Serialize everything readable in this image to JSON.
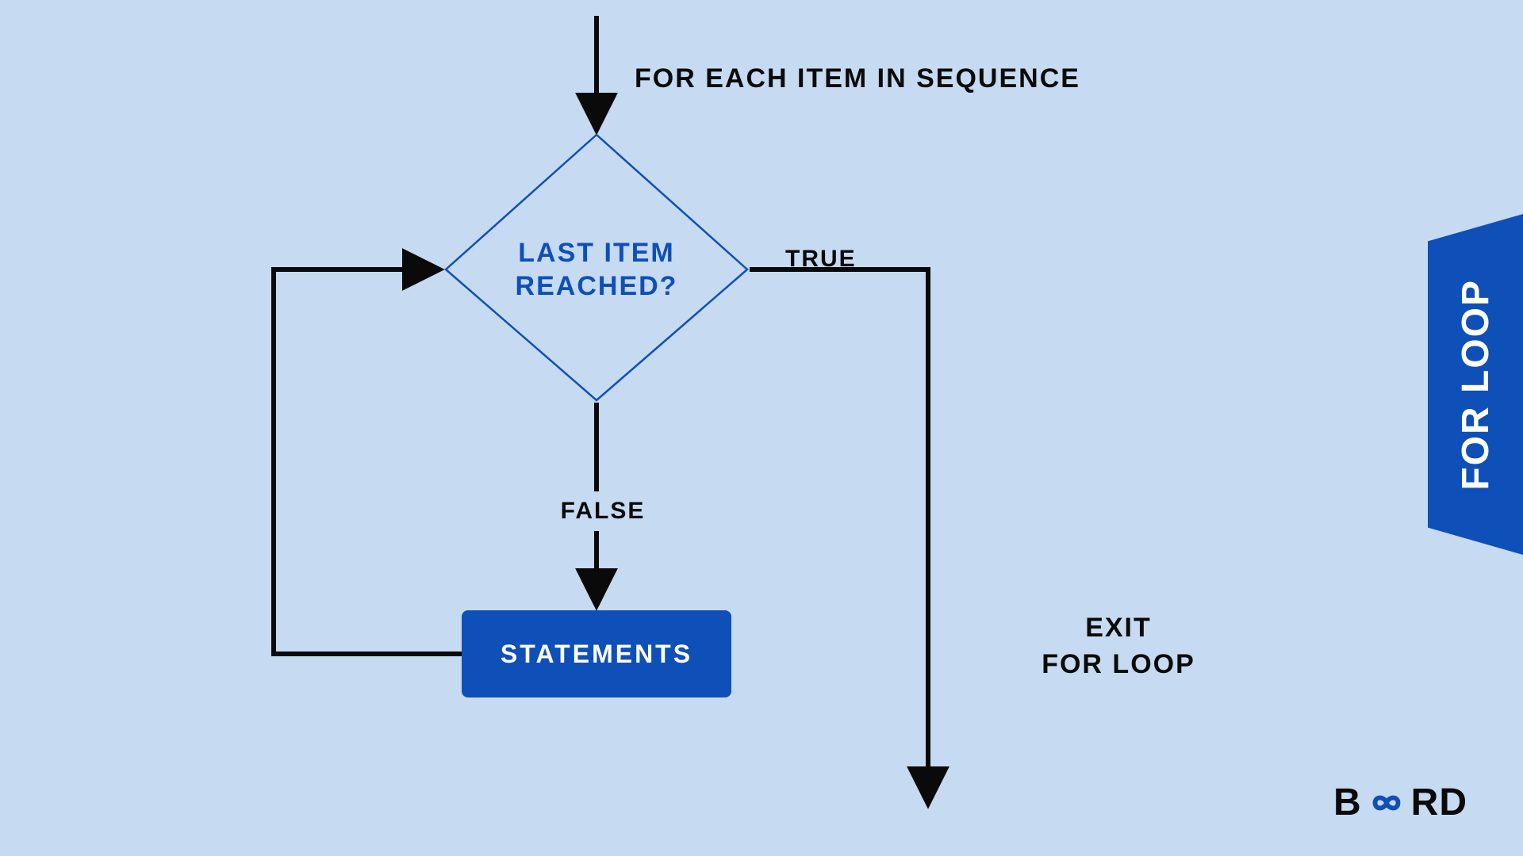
{
  "labels": {
    "top": "FOR EACH ITEM IN SEQUENCE",
    "decision_line1": "LAST ITEM",
    "decision_line2": "REACHED?",
    "true": "TRUE",
    "false": "FALSE",
    "process": "STATEMENTS",
    "exit_line1": "EXIT",
    "exit_line2": "FOR LOOP"
  },
  "side_tab": "FOR LOOP",
  "brand": {
    "left": "B",
    "right": "RD"
  },
  "colors": {
    "bg": "#c6dbf1",
    "brand_blue": "#0f4fb8",
    "ink": "#0a0a0a"
  },
  "diagram": {
    "type": "flowchart",
    "nodes": [
      {
        "id": "start",
        "kind": "connector",
        "label": "FOR EACH ITEM IN SEQUENCE"
      },
      {
        "id": "decision",
        "kind": "decision",
        "label": "LAST ITEM REACHED?"
      },
      {
        "id": "process",
        "kind": "process",
        "label": "STATEMENTS"
      },
      {
        "id": "exit",
        "kind": "terminator",
        "label": "EXIT FOR LOOP"
      }
    ],
    "edges": [
      {
        "from": "start",
        "to": "decision"
      },
      {
        "from": "decision",
        "to": "process",
        "label": "FALSE"
      },
      {
        "from": "decision",
        "to": "exit",
        "label": "TRUE"
      },
      {
        "from": "process",
        "to": "decision"
      }
    ]
  }
}
